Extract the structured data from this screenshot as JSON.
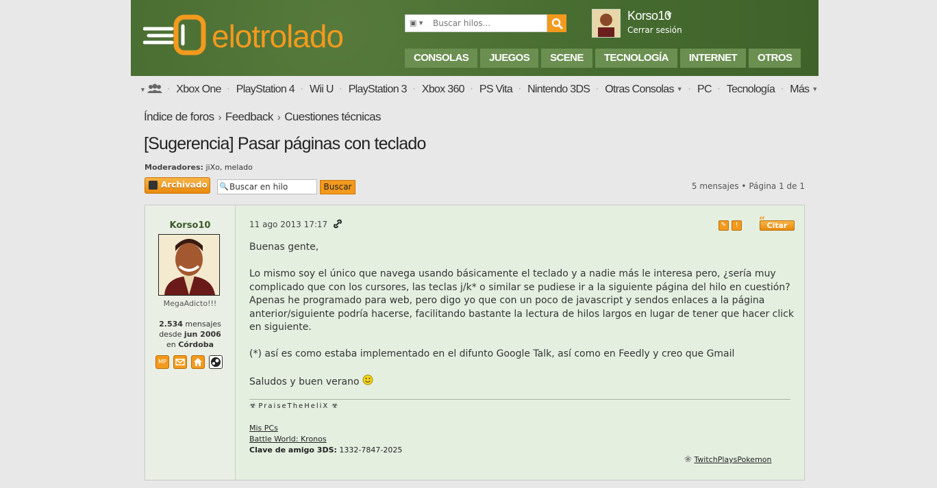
{
  "header": {
    "logo_text": "elotrolado",
    "search_placeholder": "Buscar hilos...",
    "user": {
      "name": "Korso10",
      "logout_label": "Cerrar sesión"
    },
    "top_nav": [
      "CONSOLAS",
      "JUEGOS",
      "SCENE",
      "TECNOLOGÍA",
      "INTERNET",
      "OTROS"
    ]
  },
  "platform_nav": {
    "items": [
      "Xbox One",
      "PlayStation 4",
      "Wii U",
      "PlayStation 3",
      "Xbox 360",
      "PS Vita",
      "Nintendo 3DS",
      "Otras Consolas",
      "PC",
      "Tecnología",
      "Más"
    ]
  },
  "breadcrumb": [
    "Índice de foros",
    "Feedback",
    "Cuestiones técnicas"
  ],
  "thread": {
    "title": "[Sugerencia] Pasar páginas con teclado",
    "moderators_label": "Moderadores:",
    "moderators": "jiXo, melado",
    "archived_label": "Archivado",
    "search_placeholder": "Buscar en hilo",
    "search_button": "Buscar",
    "pagination": "5 mensajes • Página 1 de 1"
  },
  "post": {
    "author": "Korso10",
    "rank": "MegaAdicto!!!",
    "stats": {
      "messages": "2.534",
      "messages_label": "mensajes",
      "since_label": "desde",
      "since": "jun 2006",
      "location_label": "en",
      "location": "Córdoba"
    },
    "contact_icons": [
      "MP",
      "email-icon",
      "home-icon",
      "steam-icon"
    ],
    "date": "11 ago 2013 17:17",
    "quote_label": "Citar",
    "paragraphs": [
      "Buenas gente,",
      "Lo mismo soy el único que navega usando básicamente el teclado y a nadie más le interesa pero, ¿sería muy complicado que con los cursores, las teclas j/k* o similar se pudiese ir a la siguiente página del hilo en cuestión? Apenas he programado para web, pero digo yo que con un poco de javascript y sendos enlaces a la página anterior/siguiente podría hacerse, facilitando bastante la lectura de hilos largos en lugar de tener que hacer click en siguiente.",
      "(*) así es como estaba implementado en el difunto Google Talk, así como en Feedly y creo que Gmail",
      "Saludos y buen verano"
    ],
    "signature": {
      "motto": "PraiseTheHeliX",
      "link1": "Mis PCs",
      "link2": "Battle World: Kronos",
      "friend_code_label": "Clave de amigo 3DS:",
      "friend_code": "1332-7847-2025",
      "tpp": "TwitchPlaysPokemon"
    }
  }
}
